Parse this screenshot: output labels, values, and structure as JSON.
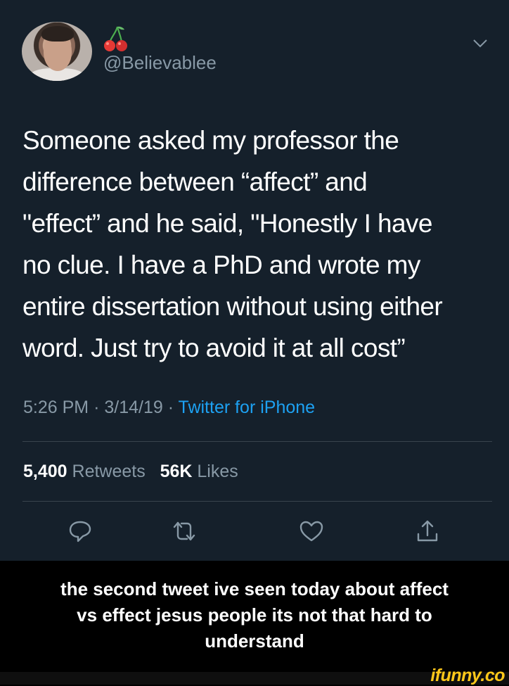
{
  "tweet": {
    "handle": "@Believablee",
    "text_lines": [
      "Someone asked my professor the",
      "difference between “affect” and",
      "\"effect” and he said, \"Honestly I have",
      "no clue. I have a PhD and wrote my",
      "entire dissertation without using either",
      "word. Just try to avoid it at all cost”"
    ],
    "time": "5:26 PM",
    "separator": "·",
    "date": "3/14/19",
    "source": "Twitter for iPhone",
    "retweets_count": "5,400",
    "retweets_label": "Retweets",
    "likes_count": "56K",
    "likes_label": "Likes"
  },
  "caption_lines": [
    "the second tweet ive seen today about affect",
    "vs effect jesus people its not that hard to",
    "understand"
  ],
  "brand": "ifunny.co",
  "colors": {
    "tweet_bg": "#15202b",
    "secondary_text": "#8899a6",
    "link": "#1da1f2",
    "divider": "#38444d",
    "brand": "#ffc81a"
  },
  "icons": [
    "cherries-emoji",
    "chevron-down-icon",
    "reply-icon",
    "retweet-icon",
    "like-icon",
    "share-icon"
  ]
}
